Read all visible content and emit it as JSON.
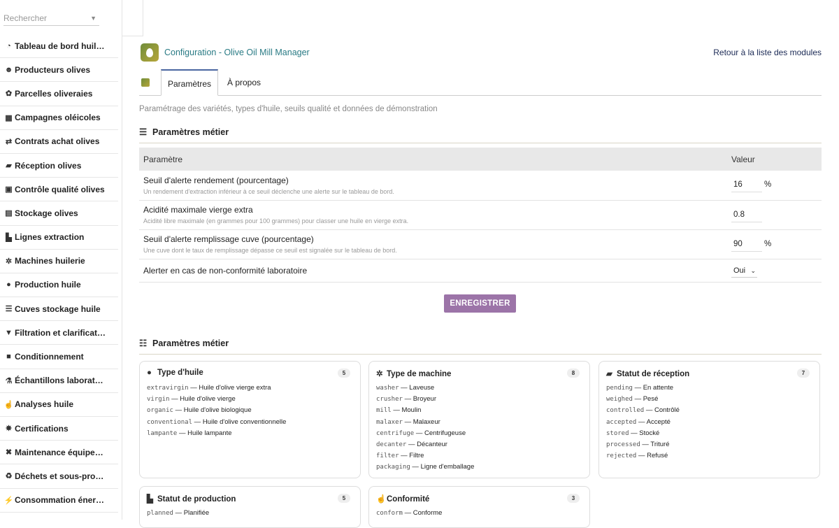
{
  "sidebar": {
    "search_placeholder": "Rechercher",
    "items": [
      {
        "icon": "dashboard-icon",
        "glyph": "◔",
        "label": "Tableau de bord huil…"
      },
      {
        "icon": "users-icon",
        "glyph": "☻",
        "label": "Producteurs olives"
      },
      {
        "icon": "seedling-icon",
        "glyph": "✿",
        "label": "Parcelles oliveraies"
      },
      {
        "icon": "calendar-icon",
        "glyph": "▦",
        "label": "Campagnes oléicoles"
      },
      {
        "icon": "handshake-icon",
        "glyph": "⇄",
        "label": "Contrats achat olives"
      },
      {
        "icon": "truck-icon",
        "glyph": "▰",
        "label": "Réception olives"
      },
      {
        "icon": "clipboard-check-icon",
        "glyph": "▣",
        "label": "Contrôle qualité olives"
      },
      {
        "icon": "boxes-icon",
        "glyph": "▤",
        "label": "Stockage olives"
      },
      {
        "icon": "industry-icon",
        "glyph": "▙",
        "label": "Lignes extraction"
      },
      {
        "icon": "cogs-icon",
        "glyph": "✲",
        "label": "Machines huilerie"
      },
      {
        "icon": "drop-icon",
        "glyph": "●",
        "label": "Production huile"
      },
      {
        "icon": "database-icon",
        "glyph": "☰",
        "label": "Cuves stockage huile"
      },
      {
        "icon": "filter-icon",
        "glyph": "▼",
        "label": "Filtration et clarificat…"
      },
      {
        "icon": "box-icon",
        "glyph": "■",
        "label": "Conditionnement"
      },
      {
        "icon": "flask-icon",
        "glyph": "⚗",
        "label": "Échantillons laborat…"
      },
      {
        "icon": "hand-flask-icon",
        "glyph": "☝",
        "label": "Analyses huile"
      },
      {
        "icon": "certificate-icon",
        "glyph": "✸",
        "label": "Certifications"
      },
      {
        "icon": "tools-icon",
        "glyph": "✖",
        "label": "Maintenance équipe…"
      },
      {
        "icon": "recycle-icon",
        "glyph": "♻",
        "label": "Déchets et sous-pro…"
      },
      {
        "icon": "bolt-icon",
        "glyph": "⚡",
        "label": "Consommation éner…"
      }
    ]
  },
  "header": {
    "title": "Configuration - Olive Oil Mill Manager",
    "back_link": "Retour à la liste des modules"
  },
  "tabs": {
    "settings": "Paramètres",
    "about": "À propos"
  },
  "subtitle": "Paramétrage des variétés, types d'huile, seuils qualité et données de démonstration",
  "params_section": {
    "title": "Paramètres métier",
    "col_param": "Paramètre",
    "col_value": "Valeur",
    "rows": [
      {
        "name": "Seuil d'alerte rendement (pourcentage)",
        "desc": "Un rendement d'extraction inférieur à ce seuil déclenche une alerte sur le tableau de bord.",
        "value": "16",
        "unit": "%"
      },
      {
        "name": "Acidité maximale vierge extra",
        "desc": "Acidité libre maximale (en grammes pour 100 grammes) pour classer une huile en vierge extra.",
        "value": "0.8",
        "unit": ""
      },
      {
        "name": "Seuil d'alerte remplissage cuve (pourcentage)",
        "desc": "Une cuve dont le taux de remplissage dépasse ce seuil est signalée sur le tableau de bord.",
        "value": "90",
        "unit": "%"
      },
      {
        "name": "Alerter en cas de non-conformité laboratoire",
        "desc": "",
        "select": "Oui"
      }
    ],
    "save_label": "ENREGISTRER"
  },
  "dict_section": {
    "title": "Paramètres métier",
    "cards": [
      {
        "title": "Type d'huile",
        "icon": "drop-icon",
        "glyph": "●",
        "count": "5",
        "entries": [
          {
            "code": "extravirgin",
            "label": "Huile d'olive vierge extra"
          },
          {
            "code": "virgin",
            "label": "Huile d'olive vierge"
          },
          {
            "code": "organic",
            "label": "Huile d'olive biologique"
          },
          {
            "code": "conventional",
            "label": "Huile d'olive conventionnelle"
          },
          {
            "code": "lampante",
            "label": "Huile lampante"
          }
        ]
      },
      {
        "title": "Type de machine",
        "icon": "cogs-icon",
        "glyph": "✲",
        "count": "8",
        "entries": [
          {
            "code": "washer",
            "label": "Laveuse"
          },
          {
            "code": "crusher",
            "label": "Broyeur"
          },
          {
            "code": "mill",
            "label": "Moulin"
          },
          {
            "code": "malaxer",
            "label": "Malaxeur"
          },
          {
            "code": "centrifuge",
            "label": "Centrifugeuse"
          },
          {
            "code": "decanter",
            "label": "Décanteur"
          },
          {
            "code": "filter",
            "label": "Filtre"
          },
          {
            "code": "packaging",
            "label": "Ligne d'emballage"
          }
        ]
      },
      {
        "title": "Statut de réception",
        "icon": "truck-icon",
        "glyph": "▰",
        "count": "7",
        "entries": [
          {
            "code": "pending",
            "label": "En attente"
          },
          {
            "code": "weighed",
            "label": "Pesé"
          },
          {
            "code": "controlled",
            "label": "Contrôlé"
          },
          {
            "code": "accepted",
            "label": "Accepté"
          },
          {
            "code": "stored",
            "label": "Stocké"
          },
          {
            "code": "processed",
            "label": "Trituré"
          },
          {
            "code": "rejected",
            "label": "Refusé"
          }
        ]
      },
      {
        "title": "Statut de production",
        "icon": "industry-icon",
        "glyph": "▙",
        "count": "5",
        "entries": [
          {
            "code": "planned",
            "label": "Planifiée"
          }
        ]
      },
      {
        "title": "Conformité",
        "icon": "hand-flask-icon",
        "glyph": "☝",
        "count": "3",
        "entries": [
          {
            "code": "conform",
            "label": "Conforme"
          }
        ]
      }
    ]
  }
}
